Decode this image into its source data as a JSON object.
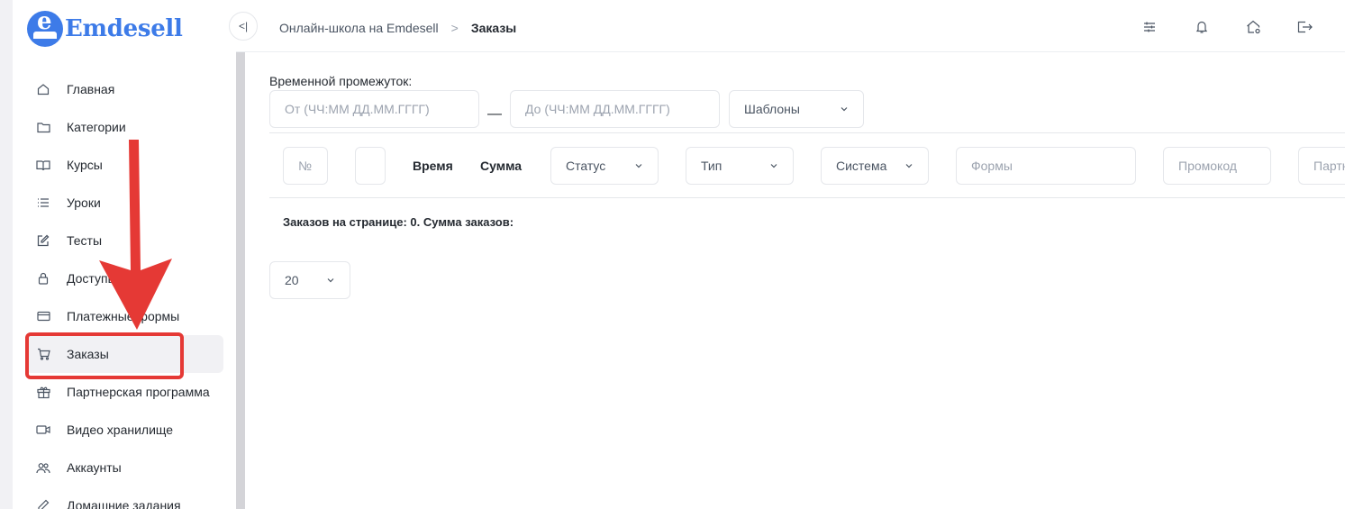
{
  "logo": {
    "letter": "e",
    "text": "Emdesell"
  },
  "sidebar": {
    "items": [
      {
        "label": "Главная",
        "icon": "home-icon"
      },
      {
        "label": "Категории",
        "icon": "folder-icon"
      },
      {
        "label": "Курсы",
        "icon": "book-icon"
      },
      {
        "label": "Уроки",
        "icon": "list-icon"
      },
      {
        "label": "Тесты",
        "icon": "edit-icon"
      },
      {
        "label": "Доступы",
        "icon": "lock-icon"
      },
      {
        "label": "Платежные формы",
        "icon": "card-icon"
      },
      {
        "label": "Заказы",
        "icon": "cart-icon",
        "active": true
      },
      {
        "label": "Партнерская программа",
        "icon": "gift-icon"
      },
      {
        "label": "Видео хранилище",
        "icon": "video-icon"
      },
      {
        "label": "Аккаунты",
        "icon": "users-icon"
      },
      {
        "label": "Домашние задания",
        "icon": "pencil-icon"
      }
    ]
  },
  "header": {
    "collapse_glyph": "<|",
    "breadcrumb": {
      "parent": "Онлайн-школа на Emdesell",
      "separator": ">",
      "current": "Заказы"
    },
    "icons": [
      "settings-sliders-icon",
      "bell-icon",
      "home-settings-icon",
      "logout-icon"
    ]
  },
  "filters": {
    "period_label": "Временной промежуток:",
    "from_placeholder": "От (ЧЧ:ММ ДД.ММ.ГГГГ)",
    "dash": "—",
    "to_placeholder": "До (ЧЧ:ММ ДД.ММ.ГГГГ)",
    "templates_label": "Шаблоны"
  },
  "columns": {
    "number_placeholder": "№",
    "time": "Время",
    "sum": "Сумма",
    "status": "Статус",
    "type": "Тип",
    "system": "Система",
    "forms_placeholder": "Формы",
    "promo_placeholder": "Промокод",
    "partner_placeholder": "Партнер"
  },
  "summary": "Заказов на странице: 0. Сумма заказов:",
  "page_size": "20",
  "annotation": {
    "color": "#e53935"
  },
  "colors": {
    "accent": "#3d7be8",
    "annotation": "#e53935"
  }
}
